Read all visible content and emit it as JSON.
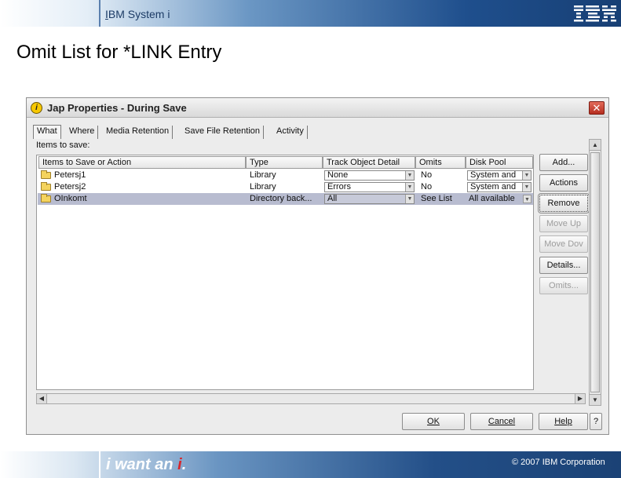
{
  "slide": {
    "header_brand": "IBM System i",
    "title": "Omit List for *LINK Entry",
    "tagline_prefix": "i want an ",
    "tagline_accent": "i",
    "tagline_suffix": ".",
    "copyright": "© 2007 IBM Corporation",
    "logo_text": "IBM"
  },
  "dialog": {
    "title": "Jap Properties - During Save",
    "close_glyph": "✕",
    "tabs": [
      {
        "label": "What"
      },
      {
        "label": "Where"
      },
      {
        "label": "Media Retention"
      },
      {
        "label": "Save File Retention"
      },
      {
        "label": "Activity"
      }
    ],
    "items_label": "Items to save:",
    "table": {
      "columns": [
        "Items to Save or Action",
        "Type",
        "Track Object Detail",
        "Omits",
        "Disk Pool"
      ],
      "rows": [
        {
          "name": "Petersj1",
          "type": "Library",
          "track": "None",
          "omits": "No",
          "disk_pool": "System and"
        },
        {
          "name": "Petersj2",
          "type": "Library",
          "track": "Errors",
          "omits": "No",
          "disk_pool": "System and"
        },
        {
          "name": "OInkomt",
          "type": "Directory back...",
          "track": "All",
          "omits": "See List",
          "disk_pool": "All available"
        }
      ],
      "selected_row": 2
    },
    "side_buttons": [
      {
        "label": "Add...",
        "enabled": true
      },
      {
        "label": "Actions",
        "enabled": true
      },
      {
        "label": "Remove",
        "enabled": true
      },
      {
        "label": "Move Up",
        "enabled": false
      },
      {
        "label": "Move Dov",
        "enabled": false
      },
      {
        "label": "Details...",
        "enabled": true
      },
      {
        "label": "Omits...",
        "enabled": false
      }
    ],
    "bottom_buttons": {
      "ok": "OK",
      "cancel": "Cancel",
      "help": "Help",
      "question": "?"
    }
  },
  "colors": {
    "selected_row": "#b8bcd0",
    "tagline_accent": "#d8262c",
    "header_blue": "#1f4f8d"
  }
}
